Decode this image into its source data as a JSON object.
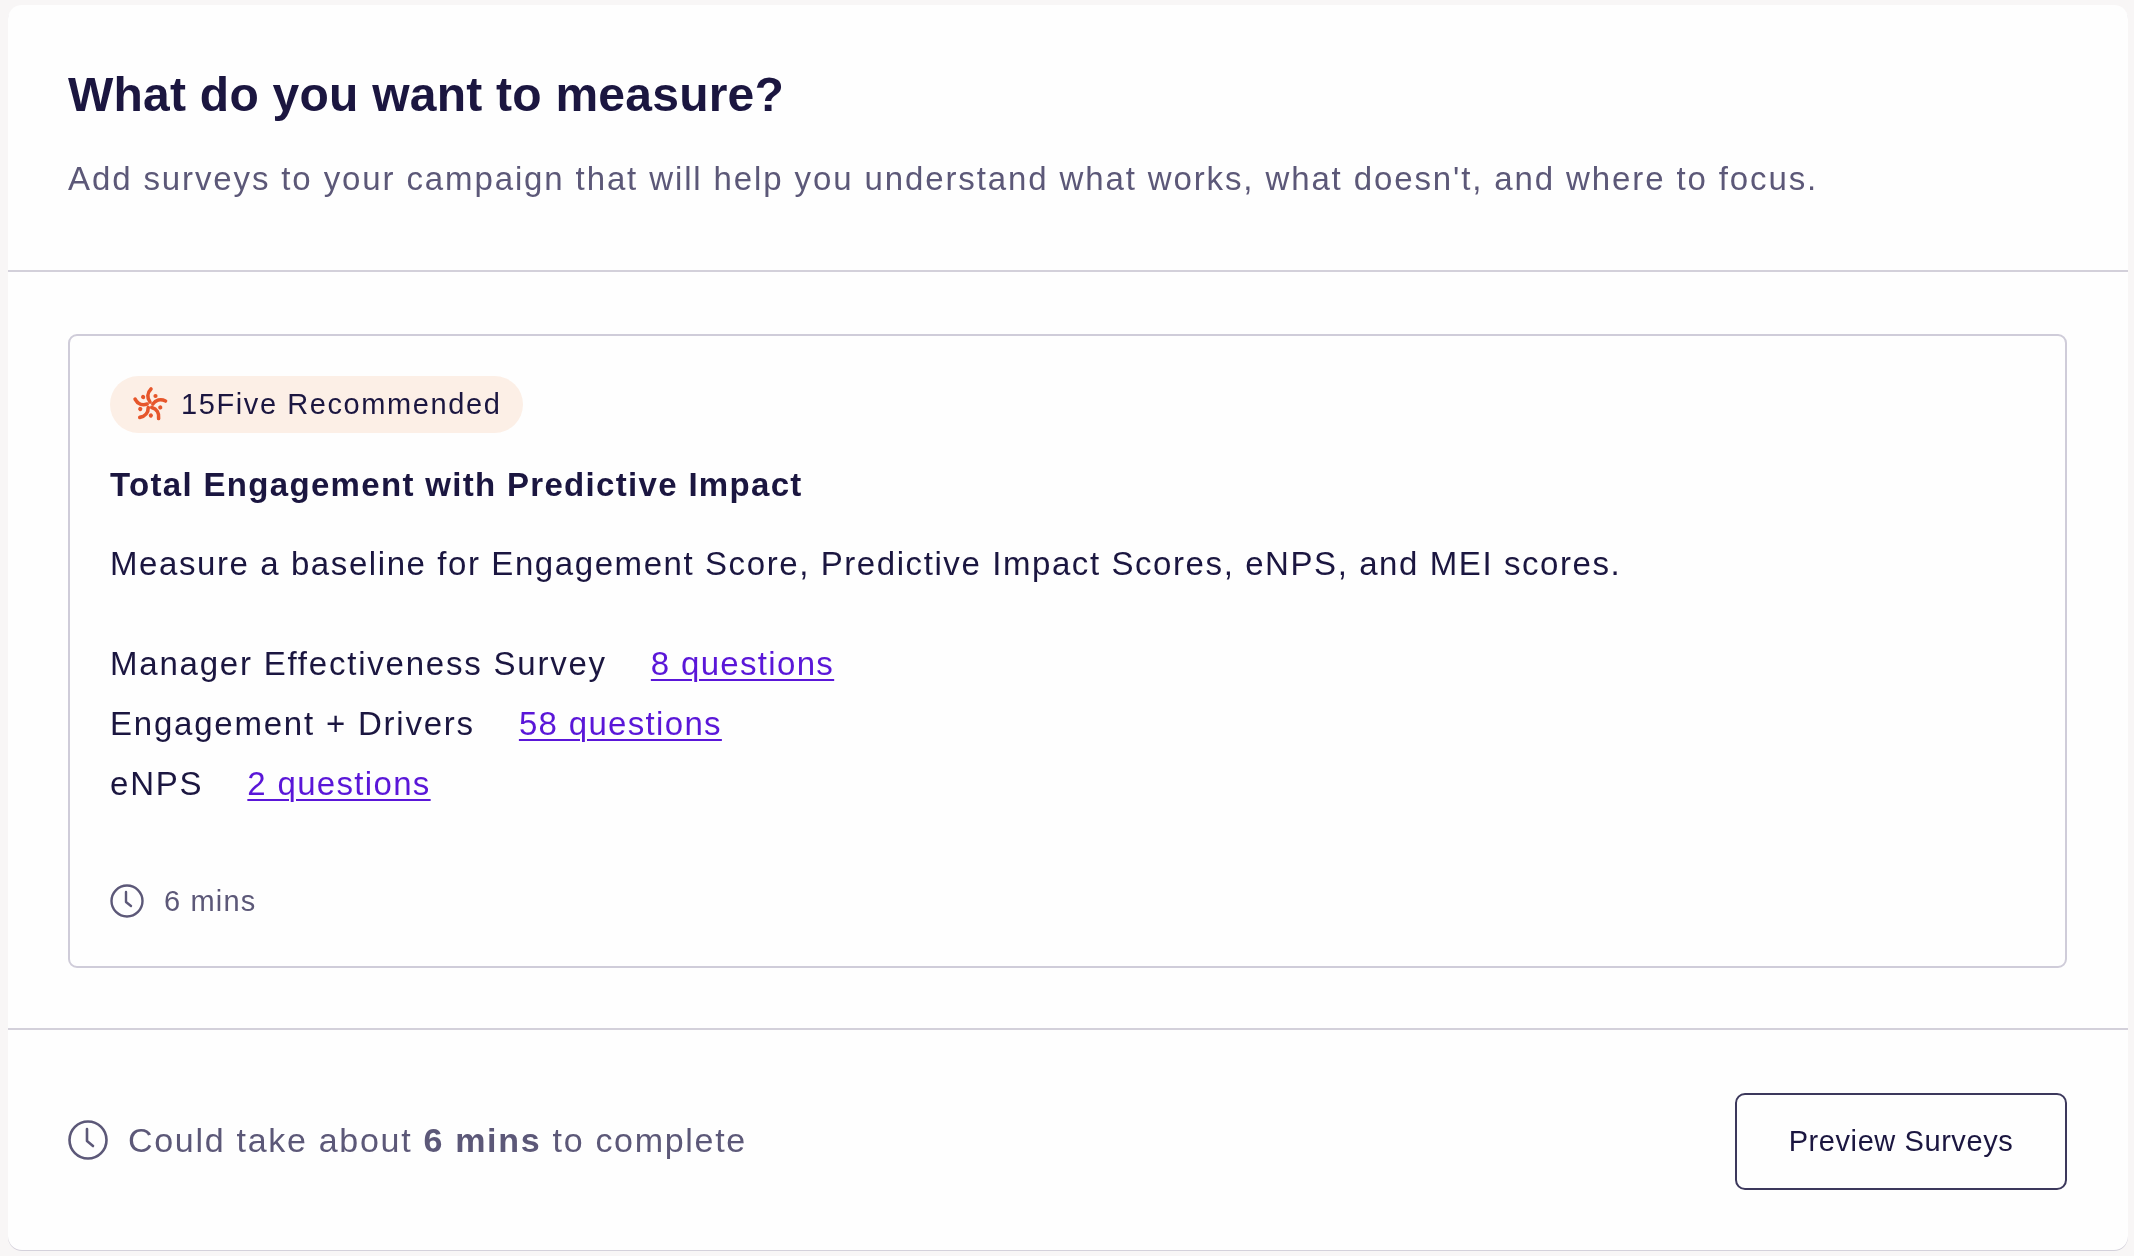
{
  "header": {
    "title": "What do you want to measure?",
    "subtitle": "Add surveys to your campaign that will help you understand what works, what doesn't, and where to focus."
  },
  "recommendation": {
    "badge": "15Five Recommended",
    "title": "Total Engagement with Predictive Impact",
    "description": "Measure a baseline for Engagement Score, Predictive Impact Scores, eNPS, and MEI scores.",
    "surveys": [
      {
        "name": "Manager Effectiveness Survey",
        "questions": "8 questions"
      },
      {
        "name": "Engagement + Drivers",
        "questions": "58 questions"
      },
      {
        "name": "eNPS",
        "questions": "2 questions"
      }
    ],
    "duration": "6 mins"
  },
  "footer": {
    "estimate": "Could take about **6 mins** to complete",
    "button": "Preview Surveys"
  }
}
